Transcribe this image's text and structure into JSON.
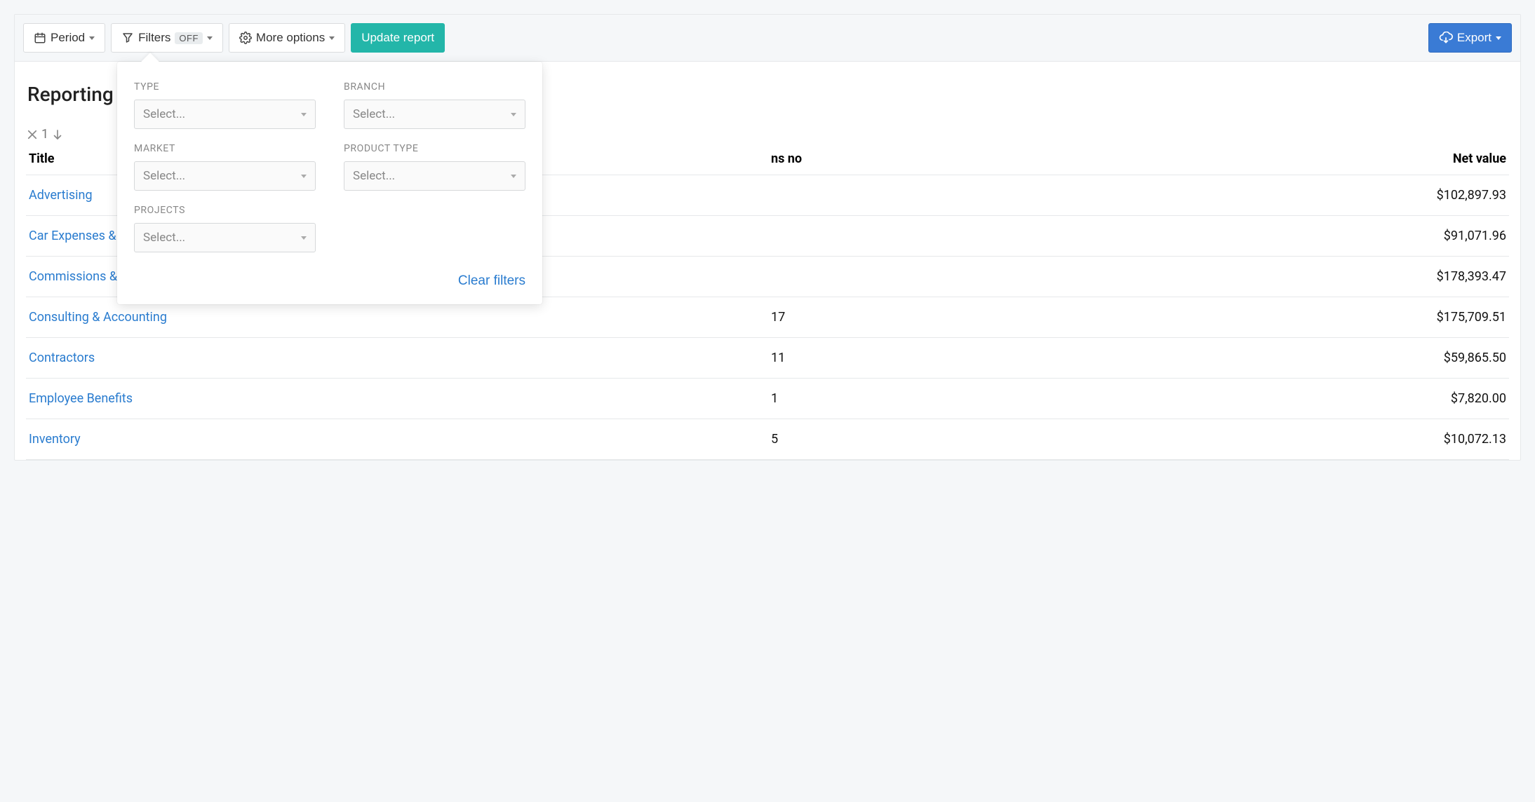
{
  "toolbar": {
    "period_label": "Period",
    "filters_label": "Filters",
    "filters_badge": "OFF",
    "more_options_label": "More options",
    "update_label": "Update report",
    "export_label": "Export"
  },
  "page_title_prefix": "Reporting per",
  "sort": {
    "count": "1"
  },
  "columns": {
    "title": "Title",
    "trans_no": "ns no",
    "net_value": "Net value"
  },
  "rows": [
    {
      "title": "Advertising",
      "trans_no": "",
      "net_value": "$102,897.93"
    },
    {
      "title": "Car Expenses &",
      "trans_no": "",
      "net_value": "$91,071.96"
    },
    {
      "title": "Commissions &",
      "trans_no": "",
      "net_value": "$178,393.47"
    },
    {
      "title": "Consulting & Accounting",
      "trans_no": "17",
      "net_value": "$175,709.51"
    },
    {
      "title": "Contractors",
      "trans_no": "11",
      "net_value": "$59,865.50"
    },
    {
      "title": "Employee Benefits",
      "trans_no": "1",
      "net_value": "$7,820.00"
    },
    {
      "title": "Inventory",
      "trans_no": "5",
      "net_value": "$10,072.13"
    }
  ],
  "filters_popover": {
    "type_label": "TYPE",
    "branch_label": "BRANCH",
    "market_label": "MARKET",
    "product_type_label": "PRODUCT TYPE",
    "projects_label": "PROJECTS",
    "select_placeholder": "Select...",
    "clear_label": "Clear filters"
  }
}
